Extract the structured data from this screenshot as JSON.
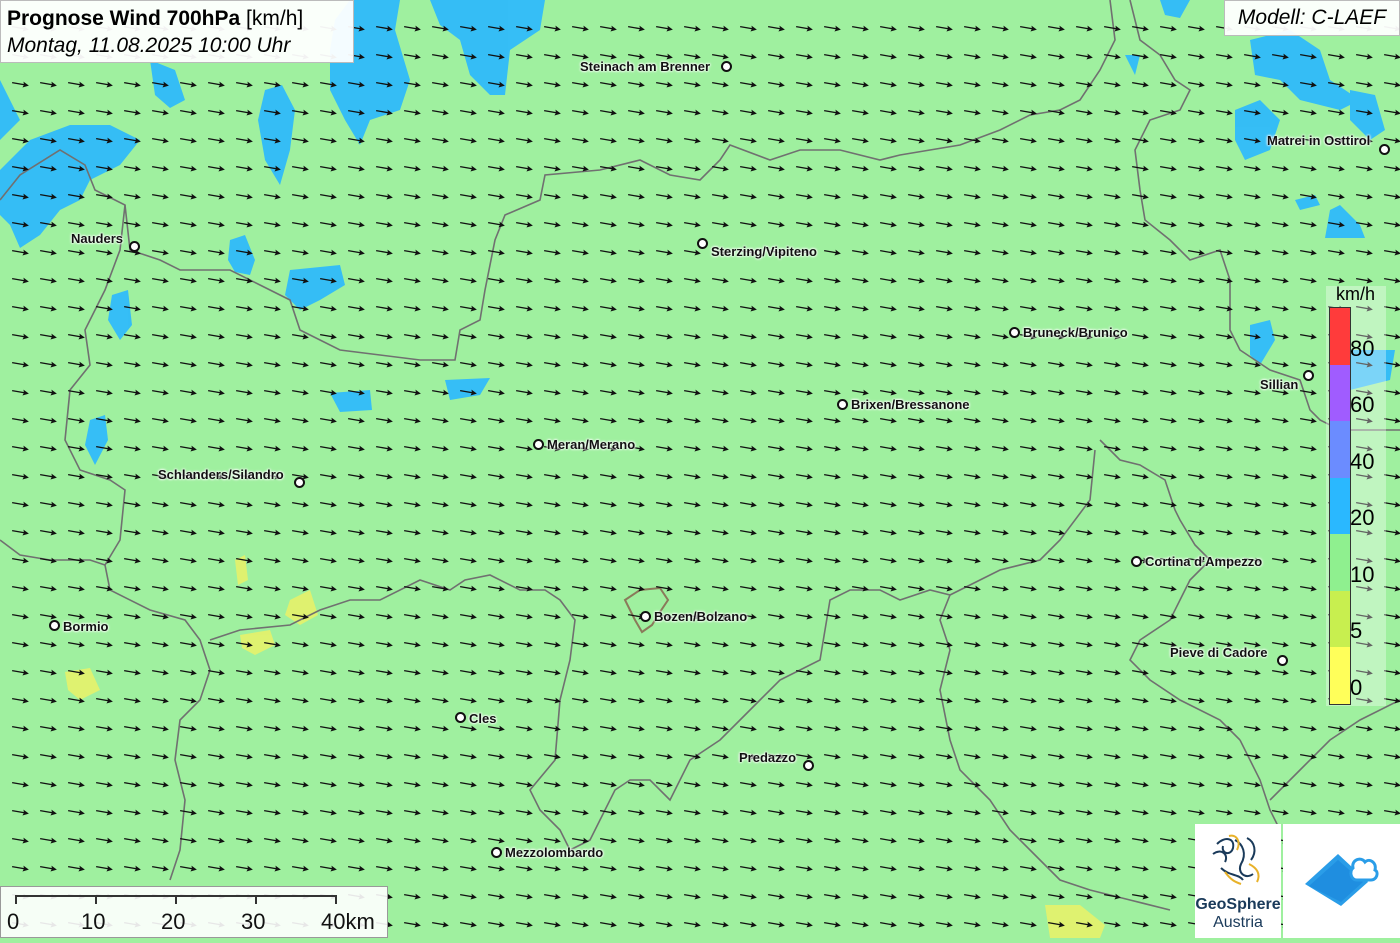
{
  "header": {
    "title_bold": "Prognose Wind 700hPa",
    "title_unit": "[km/h]",
    "datetime": "Montag, 11.08.2025 10:00 Uhr",
    "model": "Modell: C-LAEF"
  },
  "legend": {
    "unit": "km/h",
    "labels": [
      "80",
      "60",
      "40",
      "20",
      "10",
      "5",
      "0"
    ],
    "colors": [
      "#ff3b3b",
      "#a05cff",
      "#6b8cff",
      "#2ab8ff",
      "#8ff08f",
      "#c8ef4f",
      "#ffff5a"
    ]
  },
  "cities": [
    {
      "name": "Steinach am Brenner"
    },
    {
      "name": "Matrei in Osttirol"
    },
    {
      "name": "Nauders"
    },
    {
      "name": "Sterzing/Vipiteno"
    },
    {
      "name": "Bruneck/Brunico"
    },
    {
      "name": "Sillian"
    },
    {
      "name": "Brixen/Bressanone"
    },
    {
      "name": "Meran/Merano"
    },
    {
      "name": "Schlanders/Silandro"
    },
    {
      "name": "Cortina d'Ampezzo"
    },
    {
      "name": "Bormio"
    },
    {
      "name": "Bozen/Bolzano"
    },
    {
      "name": "Pieve di Cadore"
    },
    {
      "name": "Cles"
    },
    {
      "name": "Predazzo"
    },
    {
      "name": "Mezzolombardo"
    }
  ],
  "scale": {
    "labels": [
      "0",
      "10",
      "20",
      "30",
      "40km"
    ]
  },
  "logos": {
    "geosphere_line1": "GeoSphere",
    "geosphere_line2": "Austria"
  },
  "colors": {
    "land": "#9ff09f",
    "water": "#2ab8ff",
    "low_wind": "#e6f26a",
    "arrow": "#111111",
    "border": "#707070"
  },
  "wind": {
    "direction": "east-southeast"
  }
}
